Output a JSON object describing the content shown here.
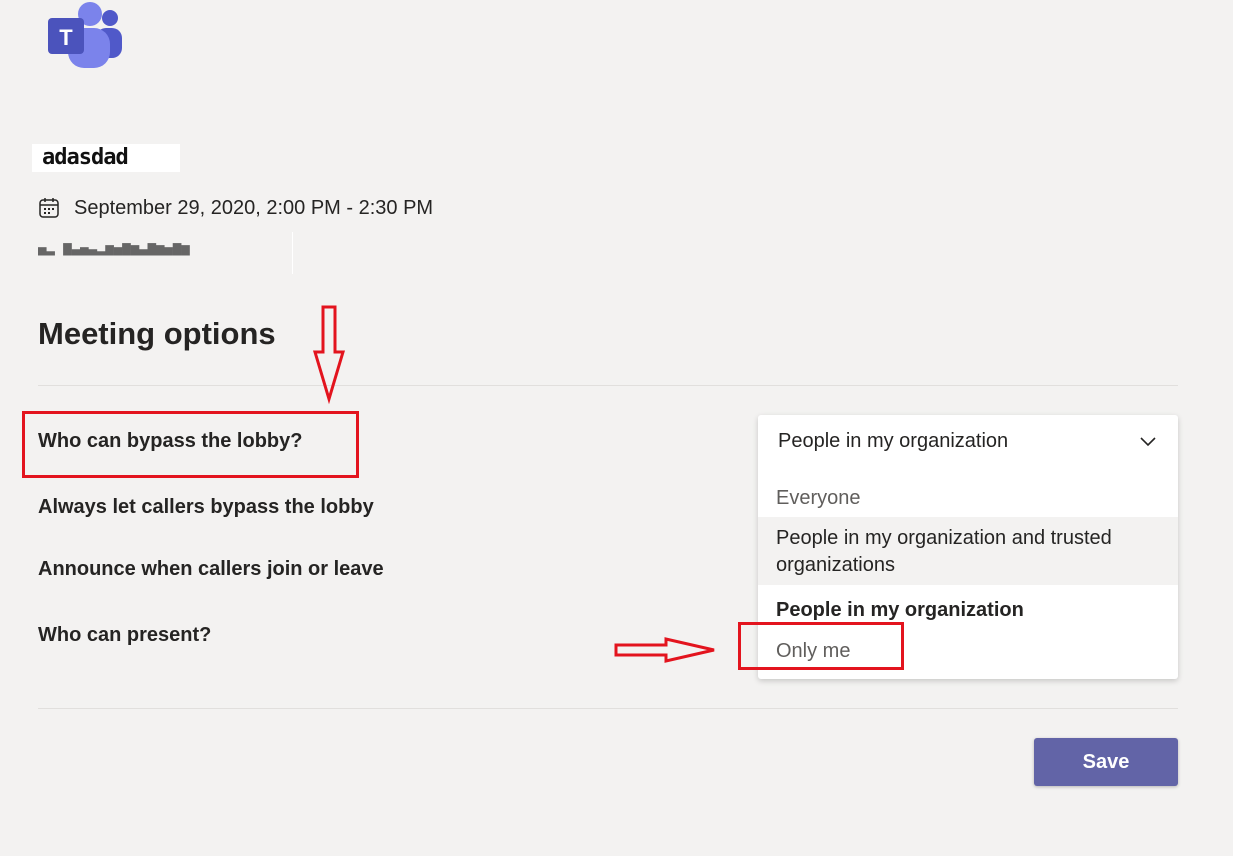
{
  "app": {
    "logo_letter": "T",
    "brand_color": "#6264a7"
  },
  "meeting": {
    "title": "adasdad",
    "datetime": "September 29, 2020, 2:00 PM - 2:30 PM",
    "organizer": "▄▂ ▆▃▄▃▂▅▄▆▅▃▆▅▄▆▅"
  },
  "page": {
    "heading": "Meeting options"
  },
  "options": [
    {
      "label": "Who can bypass the lobby?"
    },
    {
      "label": "Always let callers bypass the lobby"
    },
    {
      "label": "Announce when callers join or leave"
    },
    {
      "label": "Who can present?"
    }
  ],
  "lobby_dropdown": {
    "selected": "People in my organization",
    "icon": "chevron-down-icon",
    "options": [
      "Everyone",
      "People in my organization and trusted organizations",
      "People in my organization",
      "Only me"
    ]
  },
  "save_label": "Save",
  "annotation_color": "#e3141e"
}
